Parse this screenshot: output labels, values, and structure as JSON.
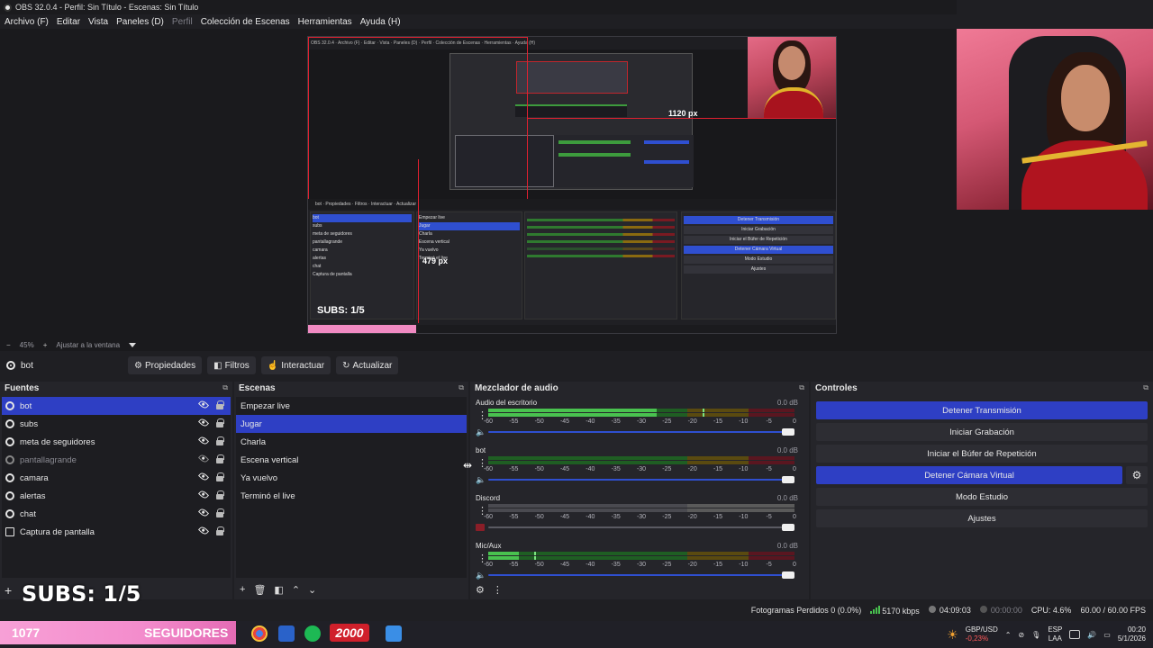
{
  "window": {
    "title": "OBS 32.0.4 - Perfil: Sin Título - Escenas: Sin Título"
  },
  "menu": [
    {
      "label": "Archivo (F)",
      "enabled": true
    },
    {
      "label": "Editar",
      "enabled": true
    },
    {
      "label": "Vista",
      "enabled": true
    },
    {
      "label": "Paneles (D)",
      "enabled": true
    },
    {
      "label": "Perfil",
      "enabled": false
    },
    {
      "label": "Colección de Escenas",
      "enabled": true
    },
    {
      "label": "Herramientas",
      "enabled": true
    },
    {
      "label": "Ayuda (H)",
      "enabled": true
    }
  ],
  "preview": {
    "width_label": "1120 px",
    "height_label": "479 px",
    "subs_text": "SUBS: 1/5",
    "nested_subs": "SUBS: 1/5",
    "nested_sources": [
      "bot",
      "subs",
      "meta de seguidores",
      "pantallagrande",
      "camara",
      "alertas",
      "chat",
      "Captura de pantalla"
    ],
    "nested_scenes": [
      "Empezar live",
      "Jugar",
      "Charla",
      "Escena vertical",
      "Ya vuelvo",
      "Terminó el live"
    ],
    "nested_controls": [
      "Detener Transmisión",
      "Iniciar Grabación",
      "Iniciar el Búfer de Repetición",
      "Detener Cámara Virtual",
      "Modo Estudio",
      "Ajustes"
    ]
  },
  "preview_toolbar": {
    "zoom_minus": "−",
    "zoom": "45%",
    "zoom_plus": "+",
    "fit": "Ajustar a la ventana"
  },
  "source_toolbar": {
    "current_source": "bot",
    "buttons": {
      "properties": "Propiedades",
      "filters": "Filtros",
      "interact": "Interactuar",
      "refresh": "Actualizar"
    }
  },
  "sources": {
    "title": "Fuentes",
    "items": [
      {
        "name": "bot",
        "type": "browser",
        "visible": true,
        "selected": true
      },
      {
        "name": "subs",
        "type": "browser",
        "visible": true
      },
      {
        "name": "meta de seguidores",
        "type": "browser",
        "visible": true
      },
      {
        "name": "pantallagrande",
        "type": "browser",
        "visible": false
      },
      {
        "name": "camara",
        "type": "browser",
        "visible": true
      },
      {
        "name": "alertas",
        "type": "browser",
        "visible": true
      },
      {
        "name": "chat",
        "type": "browser",
        "visible": true
      },
      {
        "name": "Captura de pantalla",
        "type": "monitor",
        "visible": true
      }
    ]
  },
  "scenes": {
    "title": "Escenas",
    "items": [
      {
        "name": "Empezar live"
      },
      {
        "name": "Jugar",
        "selected": true
      },
      {
        "name": "Charla"
      },
      {
        "name": "Escena vertical"
      },
      {
        "name": "Ya vuelvo"
      },
      {
        "name": "Terminó el live"
      }
    ]
  },
  "mixer": {
    "title": "Mezclador de audio",
    "ticks": [
      "-60",
      "-55",
      "-50",
      "-45",
      "-40",
      "-35",
      "-30",
      "-25",
      "-20",
      "-15",
      "-10",
      "-5",
      "0"
    ],
    "channels": [
      {
        "name": "Audio del escritorio",
        "db": "0.0 dB",
        "level": 0.55,
        "peak": 0.7,
        "muted": false
      },
      {
        "name": "bot",
        "db": "0.0 dB",
        "level": 0.0,
        "peak": 0.0,
        "muted": false
      },
      {
        "name": "Discord",
        "db": "0.0 dB",
        "level": 0.0,
        "peak": 0.0,
        "muted": true
      },
      {
        "name": "Mic/Aux",
        "db": "0.0 dB",
        "level": 0.1,
        "peak": 0.15,
        "muted": false
      }
    ]
  },
  "controls": {
    "title": "Controles",
    "buttons": [
      {
        "label": "Detener Transmisión",
        "active": true
      },
      {
        "label": "Iniciar Grabación",
        "active": false
      },
      {
        "label": "Iniciar el Búfer de Repetición",
        "active": false
      },
      {
        "label": "Detener Cámara Virtual",
        "active": true
      },
      {
        "label": "Modo Estudio",
        "active": false
      },
      {
        "label": "Ajustes",
        "active": false
      }
    ]
  },
  "status": {
    "dropped": "Fotogramas Perdidos 0 (0.0%)",
    "bitrate": "5170 kbps",
    "stream_time": "04:09:03",
    "rec_time": "00:00:00",
    "cpu": "CPU: 4.6%",
    "fps": "60.00 / 60.00 FPS"
  },
  "overlay": {
    "subs": "SUBS: 1/5",
    "followers_count": "1077",
    "followers_label": "SEGUIDORES",
    "goal": "2000"
  },
  "taskbar": {
    "fx_pair": "GBP/USD",
    "fx_change": "-0,23%",
    "lang_top": "ESP",
    "lang_bottom": "LAA",
    "time": "00:20",
    "date": "5/1/2026"
  },
  "colors": {
    "accent": "#2e3fc4",
    "selection_red": "#e02030",
    "meter_green": "#49c24f",
    "meter_yellow": "#8a6a10",
    "meter_red": "#7a1a22",
    "overlay_pink": "#f38ccc"
  }
}
